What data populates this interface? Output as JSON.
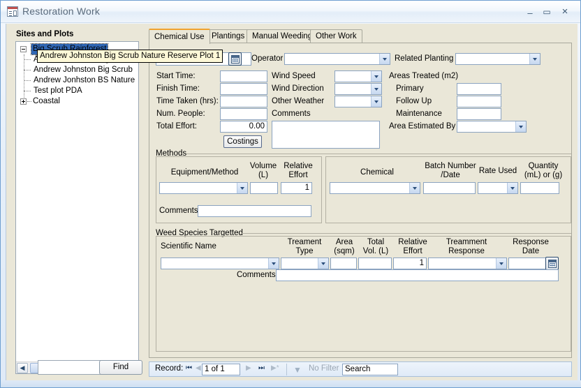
{
  "window": {
    "title": "Restoration Work",
    "icon": "form-icon",
    "minimize": "minimize-button",
    "maximize": "maximize-button",
    "close": "close-button"
  },
  "sidebar": {
    "heading": "Sites and Plots",
    "tree": [
      {
        "label": "Big Scrub Rainforest",
        "level": 0,
        "state": "expanded",
        "selected": true
      },
      {
        "label": "Andrew Johnston Big Scrub Nature Reserve Plot 1",
        "level": 1,
        "state": "leaf",
        "selected": false
      },
      {
        "label": "Andrew Johnston Big Scrub",
        "level": 1,
        "state": "leaf",
        "selected": false
      },
      {
        "label": "Andrew Jonhston BS Nature",
        "level": 1,
        "state": "leaf",
        "selected": false
      },
      {
        "label": "Test plot PDA",
        "level": 1,
        "state": "leaf",
        "selected": false
      },
      {
        "label": "Coastal",
        "level": 0,
        "state": "collapsed",
        "selected": false
      }
    ],
    "scroll_left": "◀",
    "scroll_right": "▶",
    "find_value": "",
    "find_label": "Find"
  },
  "tooltip": {
    "text": "Andrew Johnston Big Scrub Nature Reserve Plot 1"
  },
  "tabs": [
    {
      "label": "Chemical Use",
      "active": true
    },
    {
      "label": "Plantings",
      "active": false
    },
    {
      "label": "Manual Weeding",
      "active": false
    },
    {
      "label": "Other Work",
      "active": false
    }
  ],
  "form": {
    "plot_value": "",
    "calendar_button": "calendar-picker-button",
    "operator_label": "Operator",
    "operator_value": "",
    "related_planting_label": "Related Planting",
    "related_planting_value": "",
    "fields": [
      {
        "label": "Start Time:",
        "value": ""
      },
      {
        "label": "Finish Time:",
        "value": ""
      },
      {
        "label": "Time Taken (hrs):",
        "value": ""
      },
      {
        "label": "Num. People:",
        "value": ""
      },
      {
        "label": "Total Effort:",
        "value": "0.00"
      }
    ],
    "weather": [
      {
        "label": "Wind Speed",
        "value": ""
      },
      {
        "label": "Wind Direction",
        "value": ""
      },
      {
        "label": "Other Weather",
        "value": ""
      }
    ],
    "comments_label": "Comments",
    "comments_value": "",
    "costings_label": "Costings",
    "areas_heading": "Areas Treated (m2)",
    "areas": [
      {
        "label": "Primary",
        "value": ""
      },
      {
        "label": "Follow Up",
        "value": ""
      },
      {
        "label": "Maintenance",
        "value": ""
      }
    ],
    "area_estimated_by_label": "Area Estimated By",
    "area_estimated_by_value": ""
  },
  "methods": {
    "heading": "Methods",
    "columns": [
      {
        "label": "Equipment/Method"
      },
      {
        "label": "Volume\n(L)"
      },
      {
        "label": "Relative\nEffort"
      }
    ],
    "col_equipment": "Equipment/Method",
    "col_volume_1": "Volume",
    "col_volume_2": "(L)",
    "col_effort_1": "Relative",
    "col_effort_2": "Effort",
    "row": {
      "equipment": "",
      "volume": "",
      "relative_effort": "1"
    },
    "comments_label": "Comments",
    "comments_value": ""
  },
  "chemical": {
    "col_chemical": "Chemical",
    "col_batch_1": "Batch Number",
    "col_batch_2": "/Date",
    "col_rate": "Rate Used",
    "col_qty_1": "Quantity",
    "col_qty_2": "(mL) or (g)",
    "row": {
      "chemical": "",
      "batch": "",
      "rate_used": "",
      "quantity": ""
    }
  },
  "weeds": {
    "heading": "Weed Species Targetted",
    "col_scientific": "Scientific Name",
    "col_treatment_type_1": "Treament",
    "col_treatment_type_2": "Type",
    "col_area_1": "Area",
    "col_area_2": "(sqm)",
    "col_totalvol_1": "Total",
    "col_totalvol_2": "Vol. (L)",
    "col_effort_1": "Relative",
    "col_effort_2": "Effort",
    "col_response_1": "Treamment",
    "col_response_2": "Response",
    "col_respdate_1": "Response",
    "col_respdate_2": "Date",
    "row": {
      "scientific_name": "",
      "treatment_type": "",
      "area": "",
      "total_vol": "",
      "relative_effort": "1",
      "treatment_response": "",
      "response_date": ""
    },
    "comments_label": "Comments:",
    "comments_value": ""
  },
  "nav": {
    "record_label": "Record:",
    "first": "⏮",
    "prev": "◀",
    "position": "1 of 1",
    "next": "▶",
    "last": "⏭",
    "new": "▶*",
    "filter_label": "No Filter",
    "search_placeholder": "Search",
    "search_value": "Search"
  },
  "colors": {
    "form_background": "#eae7d8",
    "accent_tab": "#f0a22e",
    "selection": "#3067b5",
    "tooltip_background": "#fdf8d7",
    "window_chrome": "#dfeaf7"
  }
}
